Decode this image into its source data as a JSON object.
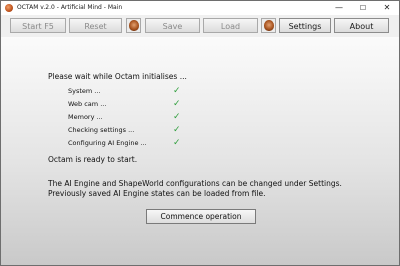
{
  "window": {
    "title": "OCTAM v.2.0 - Artificial Mind - Main",
    "controls": {
      "minimize": "—",
      "maximize": "☐",
      "close": "✕"
    }
  },
  "toolbar": {
    "start_label": "Start F5",
    "reset_label": "Reset",
    "save_label": "Save",
    "load_label": "Load",
    "settings_label": "Settings",
    "about_label": "About",
    "icon_1": "octam-face-icon",
    "icon_2": "octam-face-icon"
  },
  "main": {
    "wait_message": "Please wait while Octam initialises ...",
    "steps": [
      {
        "label": "System ...",
        "status": "✓"
      },
      {
        "label": "Web cam ...",
        "status": "✓"
      },
      {
        "label": "Memory ...",
        "status": "✓"
      },
      {
        "label": "Checking settings ...",
        "status": "✓"
      },
      {
        "label": "Configuring AI Engine ...",
        "status": "✓"
      }
    ],
    "ready_message": "Octam is ready to start.",
    "info_line_1": "The AI Engine and ShapeWorld configurations can be changed under Settings.",
    "info_line_2": "Previously saved AI Engine states can be loaded from file.",
    "commence_label": "Commence operation"
  },
  "colors": {
    "check": "#2f9e3c",
    "disabled_text": "#8a8a8a"
  }
}
